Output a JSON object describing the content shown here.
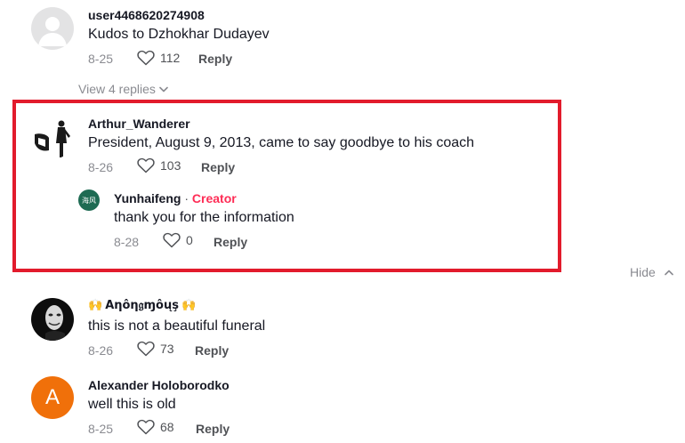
{
  "comments": [
    {
      "username": "user4468620274908",
      "text": "Kudos to Dzhokhar Dudayev",
      "date": "8-25",
      "likes": "112",
      "reply_label": "Reply",
      "view_replies": "View 4 replies"
    },
    {
      "username": "Arthur_Wanderer",
      "text": "President, August 9, 2013, came to say goodbye to his coach",
      "date": "8-26",
      "likes": "103",
      "reply_label": "Reply",
      "reply": {
        "username": "Yunhaifeng",
        "separator": "·",
        "badge": "Creator",
        "avatar_text": "海风",
        "text": "thank you for the information",
        "date": "8-28",
        "likes": "0",
        "reply_label": "Reply"
      },
      "hide_label": "Hide"
    },
    {
      "username": "Aηôη𝔤ɱôųş",
      "emoji_left": "🙌",
      "emoji_right": "🙌",
      "text": "this is not a beautiful funeral",
      "date": "8-26",
      "likes": "73",
      "reply_label": "Reply"
    },
    {
      "username": "Alexander Holoborodko",
      "avatar_letter": "A",
      "text": "well this is old",
      "date": "8-25",
      "likes": "68",
      "reply_label": "Reply"
    }
  ],
  "colors": {
    "highlight_border": "#e21b2c",
    "creator_badge": "#fe2c55",
    "reply_avatar": "#1e6b53",
    "letter_avatar": "#f0700a"
  }
}
